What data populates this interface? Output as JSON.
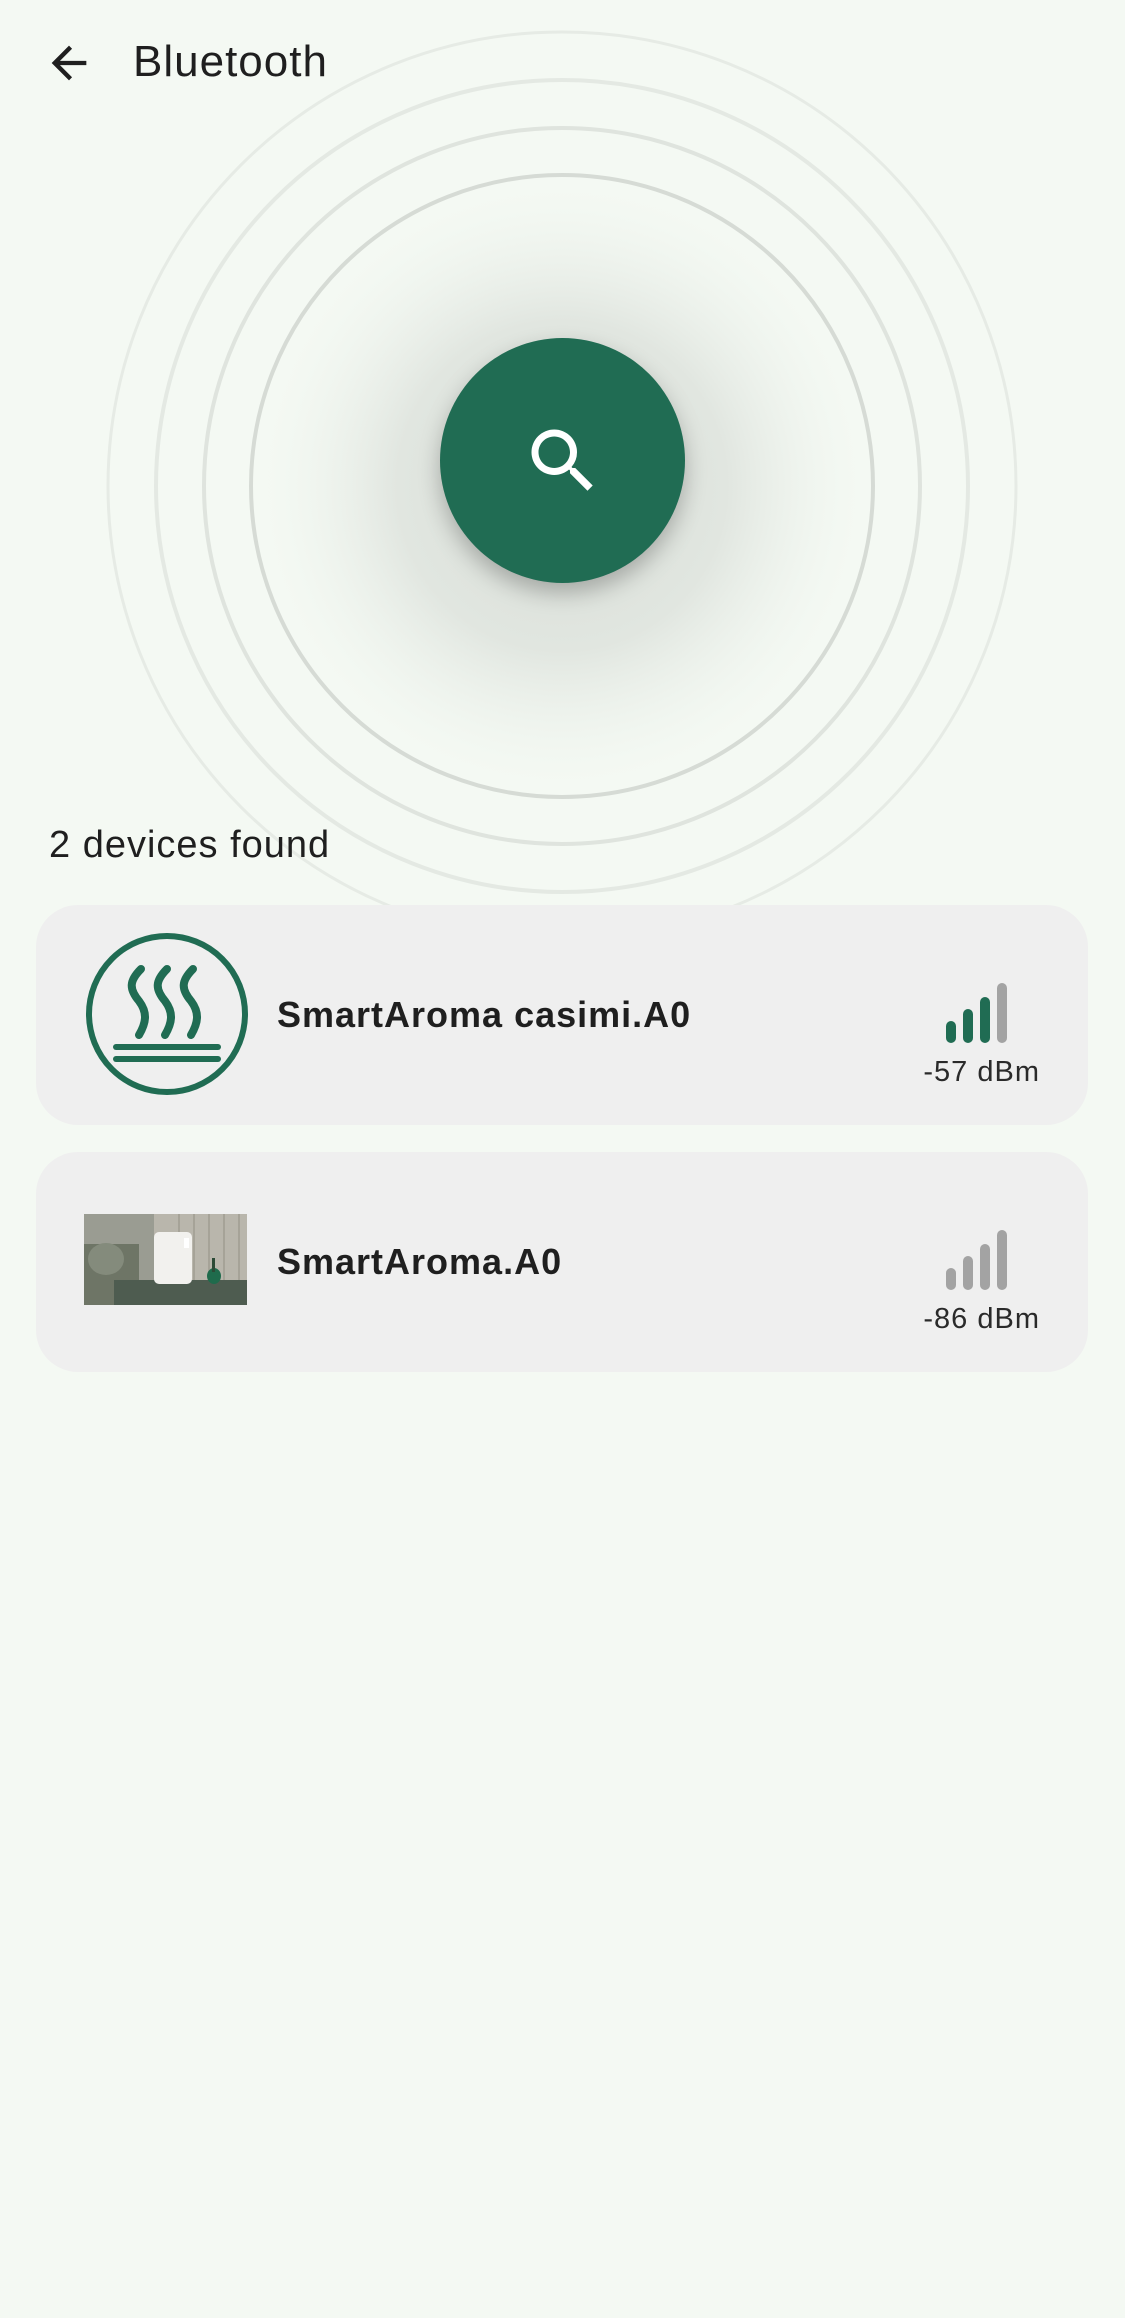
{
  "header": {
    "title": "Bluetooth",
    "back_icon": "arrow-back-icon"
  },
  "scan": {
    "icon": "search-icon",
    "color": "#206c53"
  },
  "results": {
    "summary": "2 devices found",
    "devices": [
      {
        "name": "SmartAroma casimi.A0",
        "rssi": "-57 dBm",
        "icon": "aroma-steam-icon",
        "signal_bars": 3,
        "signal_bars_total": 4
      },
      {
        "name": "SmartAroma.A0",
        "rssi": "-86 dBm",
        "icon": "device-photo",
        "signal_bars": 0,
        "signal_bars_total": 4
      }
    ]
  },
  "colors": {
    "accent": "#206c53",
    "background": "#f4f9f3",
    "card": "#efefef",
    "signal_inactive": "#a3a3a3"
  }
}
